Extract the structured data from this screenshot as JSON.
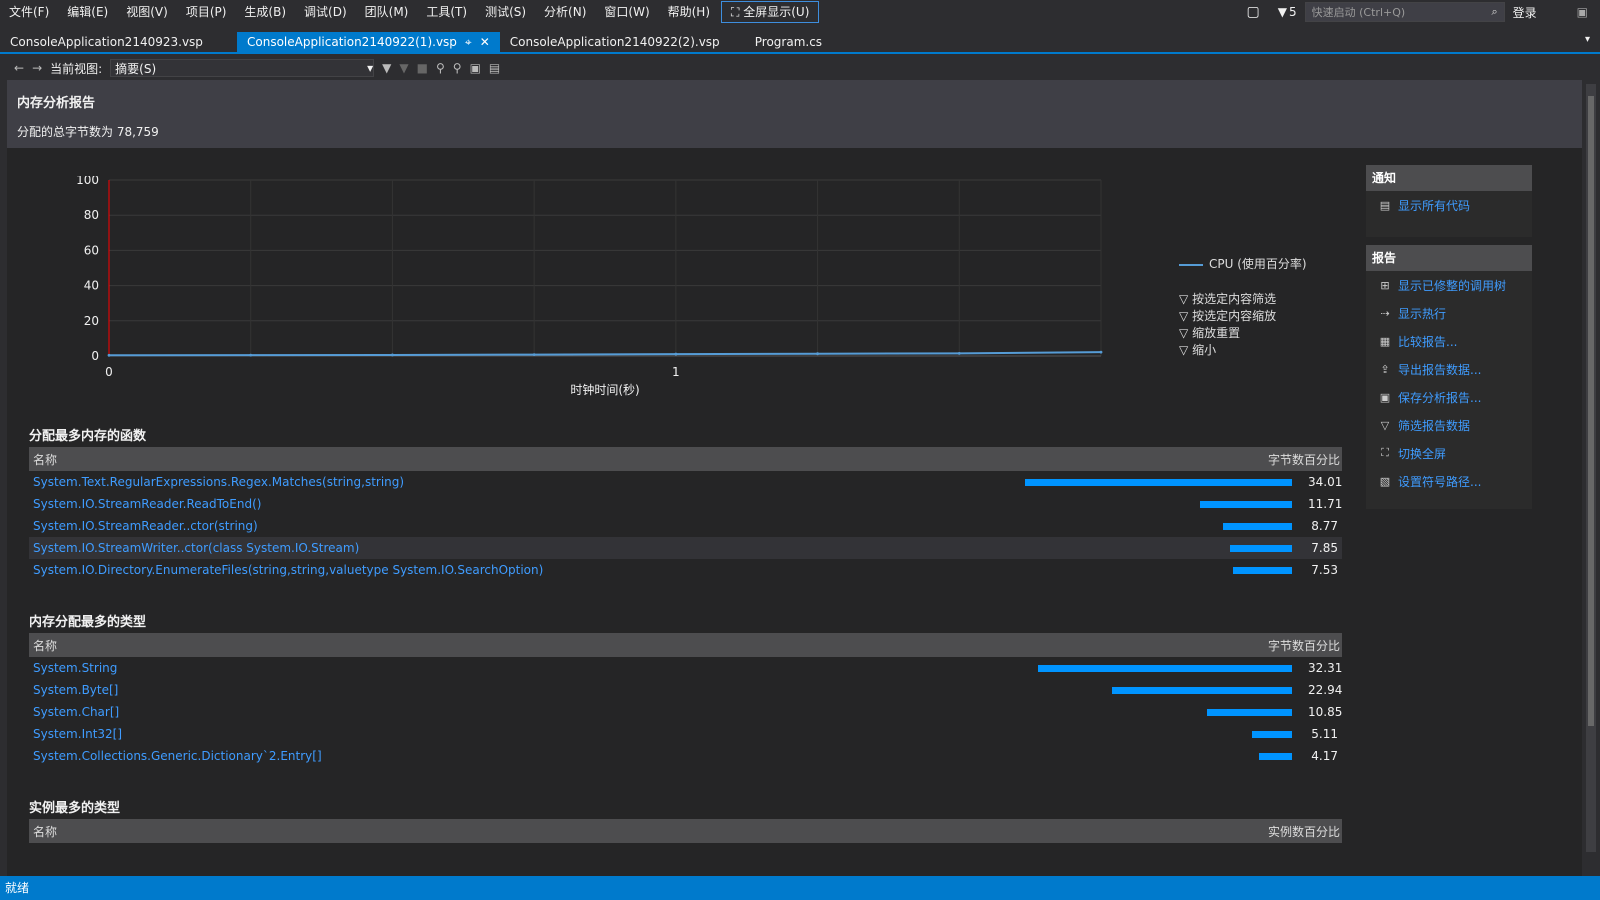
{
  "menu": {
    "items": [
      "文件(F)",
      "编辑(E)",
      "视图(V)",
      "项目(P)",
      "生成(B)",
      "调试(D)",
      "团队(M)",
      "工具(T)",
      "测试(S)",
      "分析(N)",
      "窗口(W)",
      "帮助(H)"
    ],
    "fullscreen": "全屏显示(U)",
    "notification_count": "5",
    "quick_launch": "快速启动 (Ctrl+Q)",
    "login": "登录"
  },
  "tabs": [
    {
      "label": "ConsoleApplication2140923.vsp"
    },
    {
      "label": "ConsoleApplication2140922(1).vsp"
    },
    {
      "label": "ConsoleApplication2140922(2).vsp"
    },
    {
      "label": "Program.cs"
    }
  ],
  "toolbar": {
    "current_view_label": "当前视图:",
    "current_view_value": "摘要(S)"
  },
  "report": {
    "title": "内存分析报告",
    "summary": "分配的总字节数为 78,759"
  },
  "chart_data": {
    "type": "line",
    "x": [
      0,
      0.25,
      0.5,
      0.75,
      1,
      1.25,
      1.5,
      1.75
    ],
    "series": [
      {
        "name": "CPU (使用百分率)",
        "values": [
          0.4,
          0.5,
          0.6,
          0.8,
          1.1,
          1.3,
          1.5,
          2.2
        ]
      }
    ],
    "xlabel": "时钟时间(秒)",
    "ylabel": "",
    "ylim": [
      0,
      100
    ],
    "yticks": [
      0,
      20,
      40,
      60,
      80,
      100
    ],
    "xticks": [
      0,
      1
    ],
    "grid": true,
    "legend": "top-right",
    "colors": {
      "series": "#569cd6",
      "marker": "#ff0000"
    }
  },
  "chart_actions": [
    "按选定内容筛选",
    "按选定内容缩放",
    "缩放重置",
    "缩小"
  ],
  "notifications": {
    "title": "通知",
    "items": [
      "显示所有代码"
    ]
  },
  "reports": {
    "title": "报告",
    "items": [
      "显示已修整的调用树",
      "显示热行",
      "比较报告...",
      "导出报告数据...",
      "保存分析报告...",
      "筛选报告数据",
      "切换全屏",
      "设置符号路径..."
    ]
  },
  "functions": {
    "title": "分配最多内存的函数",
    "col_name": "名称",
    "col_value": "字节数百分比",
    "rows": [
      {
        "name": "System.Text.RegularExpressions.Regex.Matches(string,string)",
        "value": "34.01",
        "percent": 34.01
      },
      {
        "name": "System.IO.StreamReader.ReadToEnd()",
        "value": "11.71",
        "percent": 11.71
      },
      {
        "name": "System.IO.StreamReader..ctor(string)",
        "value": "8.77",
        "percent": 8.77
      },
      {
        "name": "System.IO.StreamWriter..ctor(class System.IO.Stream)",
        "value": "7.85",
        "percent": 7.85
      },
      {
        "name": "System.IO.Directory.EnumerateFiles(string,string,valuetype System.IO.SearchOption)",
        "value": "7.53",
        "percent": 7.53
      }
    ]
  },
  "types": {
    "title": "内存分配最多的类型",
    "col_name": "名称",
    "col_value": "字节数百分比",
    "rows": [
      {
        "name": "System.String",
        "value": "32.31",
        "percent": 32.31
      },
      {
        "name": "System.Byte[]",
        "value": "22.94",
        "percent": 22.94
      },
      {
        "name": "System.Char[]",
        "value": "10.85",
        "percent": 10.85
      },
      {
        "name": "System.Int32[]",
        "value": "5.11",
        "percent": 5.11
      },
      {
        "name": "System.Collections.Generic.Dictionary`2.Entry[]",
        "value": "4.17",
        "percent": 4.17
      }
    ]
  },
  "instances": {
    "title": "实例最多的类型",
    "col_name": "名称",
    "col_value": "实例数百分比"
  },
  "status": {
    "text": "就绪"
  }
}
